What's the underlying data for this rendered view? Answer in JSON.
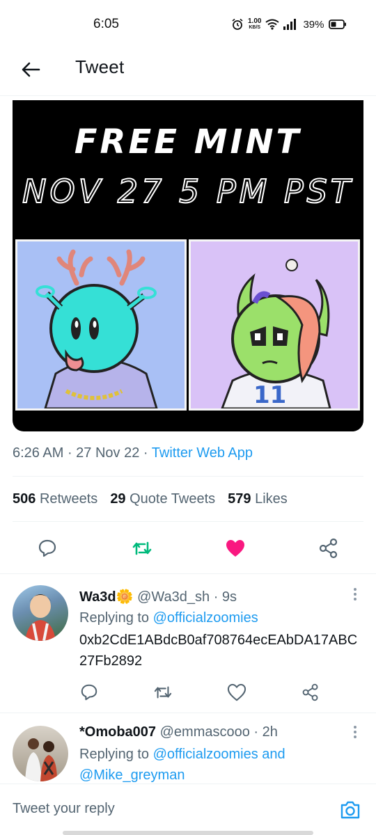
{
  "status_bar": {
    "time": "6:05",
    "speed_value": "1.00",
    "speed_unit": "KB/S",
    "battery": "39%",
    "icons": [
      "alarm-icon",
      "wifi-icon",
      "signal-icon",
      "battery-icon"
    ]
  },
  "header": {
    "title": "Tweet",
    "back_icon": "arrow-left-icon"
  },
  "media": {
    "line1": "FREE MINT",
    "line2": "NOV 27 5 PM PST"
  },
  "tweet": {
    "time": "6:26 AM",
    "date": "27 Nov 22",
    "source": "Twitter Web App",
    "retweets_count": "506",
    "retweets_label": "Retweets",
    "quotes_count": "29",
    "quotes_label": "Quote Tweets",
    "likes_count": "579",
    "likes_label": "Likes",
    "liked": true
  },
  "replies": [
    {
      "name": "Wa3d",
      "emoji": "🌼",
      "handle": "@Wa3d_sh",
      "age": "9s",
      "replying_prefix": "Replying to",
      "replying_to": "@officialzoomies",
      "text": "0xb2CdE1ABdcB0af708764ecEAbDA17ABC27Fb2892"
    },
    {
      "name": "*Omoba007",
      "handle": "@emmascooo",
      "age": "2h",
      "replying_prefix": "Replying to",
      "replying_to": "@officialzoomies and",
      "replying_to_2": "@Mike_greyman"
    }
  ],
  "composer": {
    "placeholder": "Tweet your reply",
    "camera_icon": "camera-icon"
  },
  "colors": {
    "accent": "#1d9bf0",
    "retweet_green": "#00ba7c",
    "like_pink": "#f91880",
    "secondary_text": "#536471"
  }
}
